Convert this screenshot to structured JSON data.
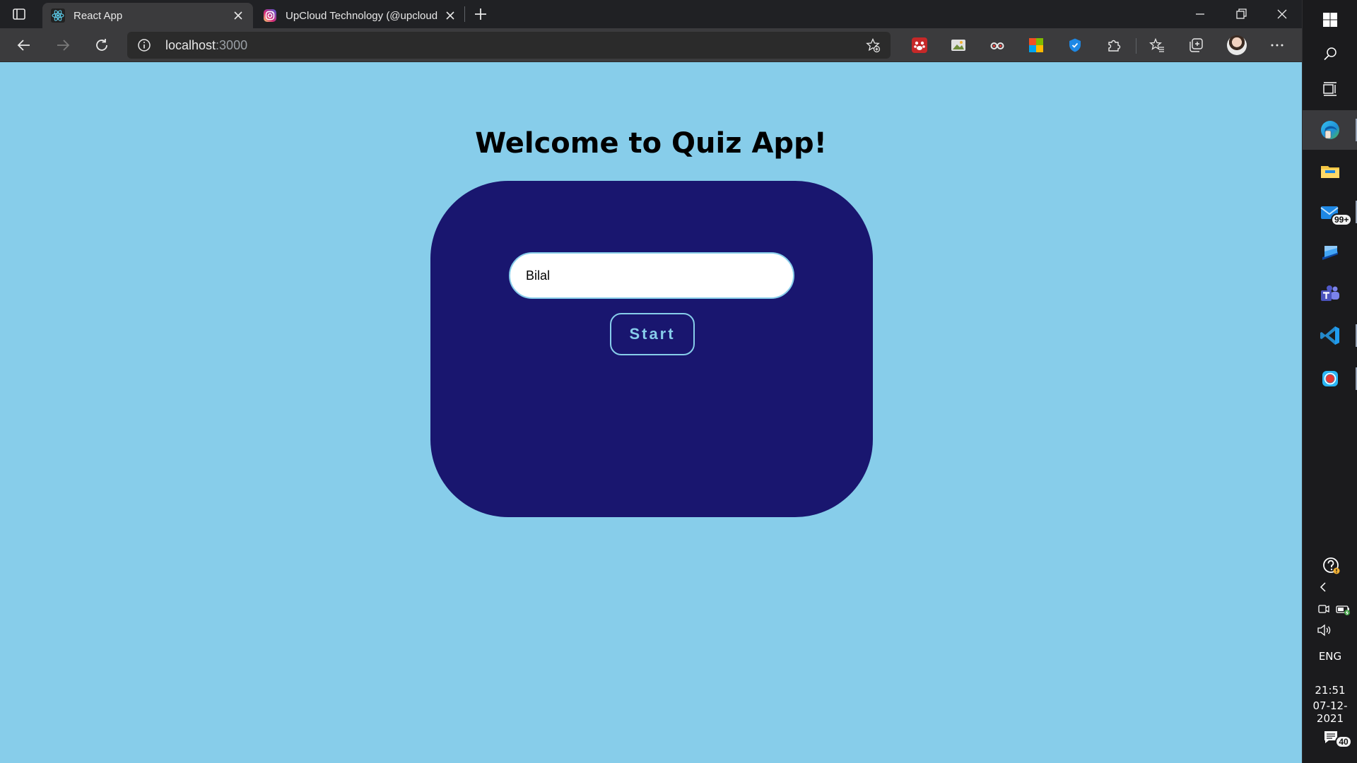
{
  "browser": {
    "tabs": [
      {
        "title": "React App",
        "favicon": "react-icon",
        "active": true
      },
      {
        "title": "UpCloud Technology (@upcloud",
        "favicon": "instagram-icon",
        "active": false
      }
    ],
    "address": {
      "host": "localhost",
      "port": ":3000"
    },
    "extensions": [
      "paw-extension-icon",
      "image-extension-icon",
      "glasses-extension-icon",
      "color-grid-extension-icon",
      "shield-extension-icon"
    ]
  },
  "page": {
    "heading": "Welcome to Quiz App!",
    "name_input_value": "Bilal",
    "start_label": "Start",
    "colors": {
      "background": "#87cdea",
      "card": "#19166f",
      "accent": "#87cdea"
    }
  },
  "taskbar": {
    "apps": [
      "edge-icon",
      "file-explorer-icon",
      "mail-icon",
      "remote-desktop-icon",
      "teams-icon",
      "vscode-icon",
      "screen-recorder-icon"
    ],
    "mail_badge": "99+",
    "language": "ENG",
    "time": "21:51",
    "date": "07-12-2021",
    "notifications_count": "40"
  }
}
